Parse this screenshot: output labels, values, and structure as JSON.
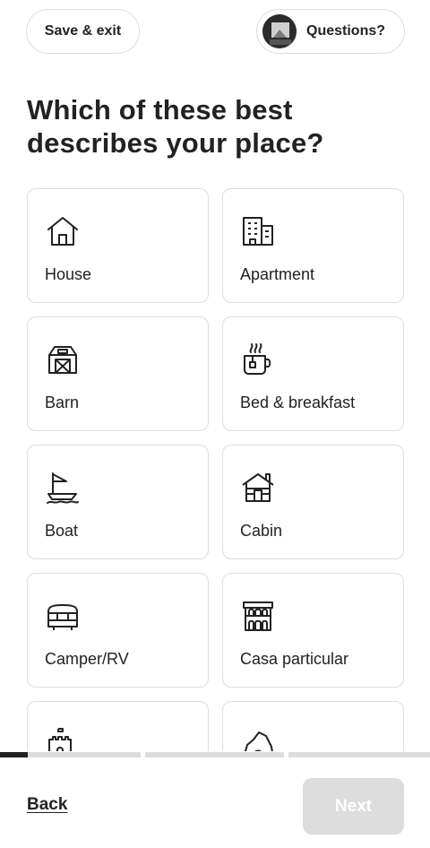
{
  "header": {
    "save_exit_label": "Save & exit",
    "questions_label": "Questions?"
  },
  "title": "Which of these best describes your place?",
  "options": [
    {
      "label": "House",
      "icon": "house-icon"
    },
    {
      "label": "Apartment",
      "icon": "apartment-icon"
    },
    {
      "label": "Barn",
      "icon": "barn-icon"
    },
    {
      "label": "Bed & breakfast",
      "icon": "bed-breakfast-icon"
    },
    {
      "label": "Boat",
      "icon": "boat-icon"
    },
    {
      "label": "Cabin",
      "icon": "cabin-icon"
    },
    {
      "label": "Camper/RV",
      "icon": "camper-icon"
    },
    {
      "label": "Casa particular",
      "icon": "casa-particular-icon"
    },
    {
      "label": "",
      "icon": "castle-icon"
    },
    {
      "label": "",
      "icon": "cave-icon"
    }
  ],
  "progress": {
    "segments": 3,
    "current_segment_fill": 0.2
  },
  "footer": {
    "back_label": "Back",
    "next_label": "Next"
  },
  "colors": {
    "text": "#222222",
    "border": "#dddddd",
    "disabled_button": "#dddddd",
    "progress_fill": "#222222"
  }
}
